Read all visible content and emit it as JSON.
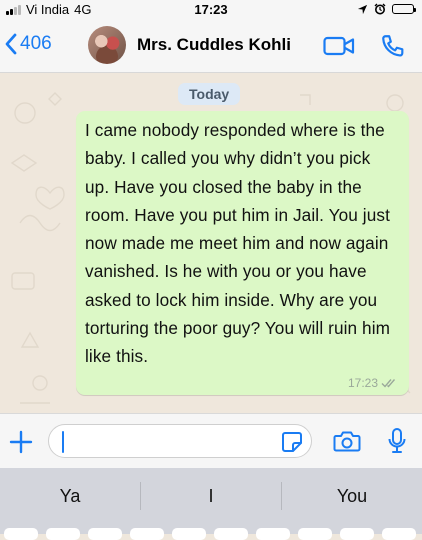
{
  "status_bar": {
    "carrier": "Vi India",
    "network": "4G",
    "time": "17:23"
  },
  "header": {
    "back_count": "406",
    "contact_name": "Mrs. Cuddles Kohli",
    "icons": [
      "chevron-left-icon",
      "avatar",
      "video-call-icon",
      "phone-icon"
    ]
  },
  "chat": {
    "date_label": "Today",
    "message": {
      "text": "I came nobody responded where is the baby. I called you why didn’t you pick up. Have you closed the baby in the room. Have you put him in Jail. You just now made me meet him and now again vanished. Is he with you or you have asked to lock him inside. Why are you torturing the poor guy? You will ruin him like this.",
      "time": "17:23",
      "status": "read"
    }
  },
  "input": {
    "value": "",
    "icons": [
      "plus-icon",
      "sticker-icon",
      "camera-icon",
      "mic-icon"
    ]
  },
  "keyboard": {
    "suggestions": [
      "Ya",
      "I",
      "You"
    ]
  },
  "colors": {
    "accent": "#1a7cf3",
    "bubble_outgoing": "#dcf8c6",
    "chat_background": "#efe7dc",
    "date_chip": "#dde9f6"
  }
}
